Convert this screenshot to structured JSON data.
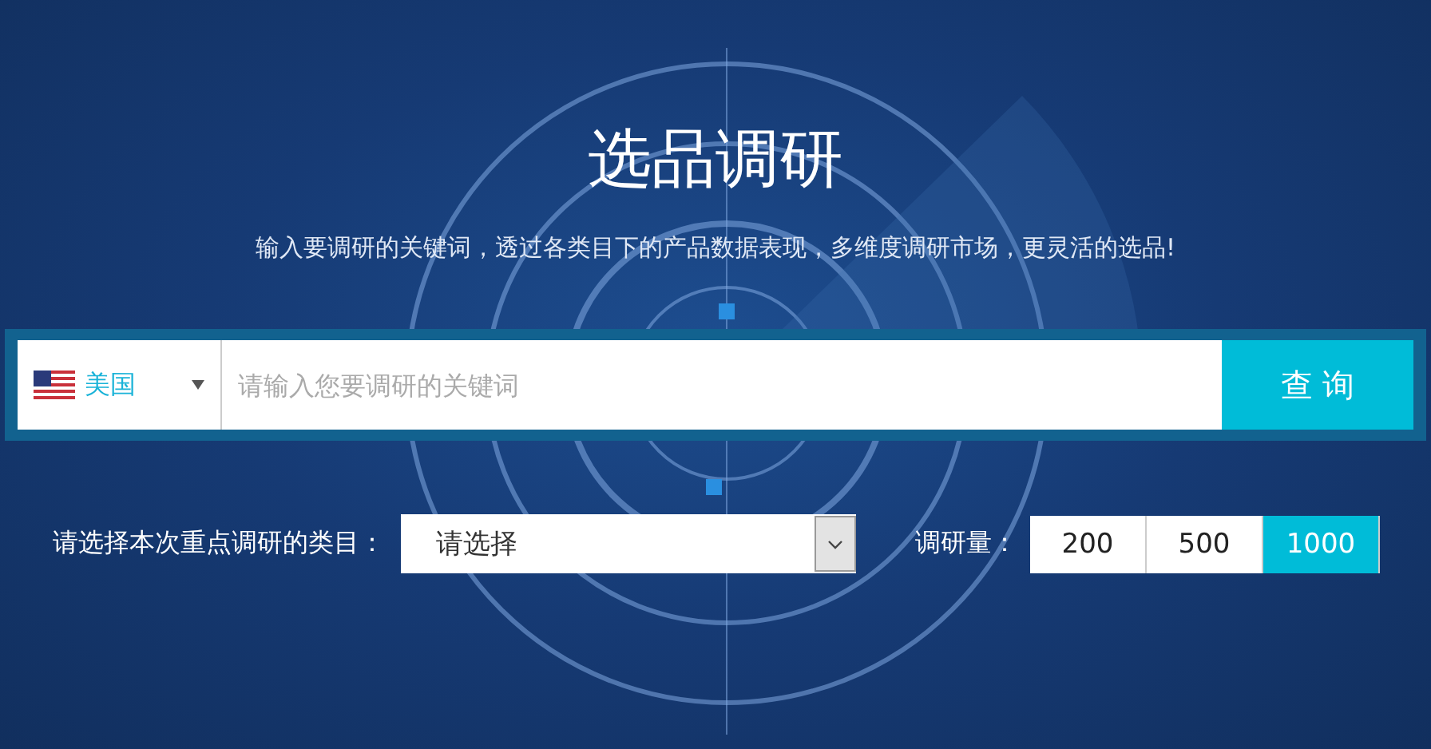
{
  "title": "选品调研",
  "subtitle": "输入要调研的关键词，透过各类目下的产品数据表现，多维度调研市场，更灵活的选品!",
  "search": {
    "country": "美国",
    "placeholder": "请输入您要调研的关键词",
    "button": "查 询"
  },
  "category": {
    "label": "请选择本次重点调研的类目：",
    "value": "请选择"
  },
  "volume": {
    "label": "调研量：",
    "options": [
      {
        "label": "200",
        "selected": false
      },
      {
        "label": "500",
        "selected": false
      },
      {
        "label": "1000",
        "selected": true
      }
    ]
  }
}
